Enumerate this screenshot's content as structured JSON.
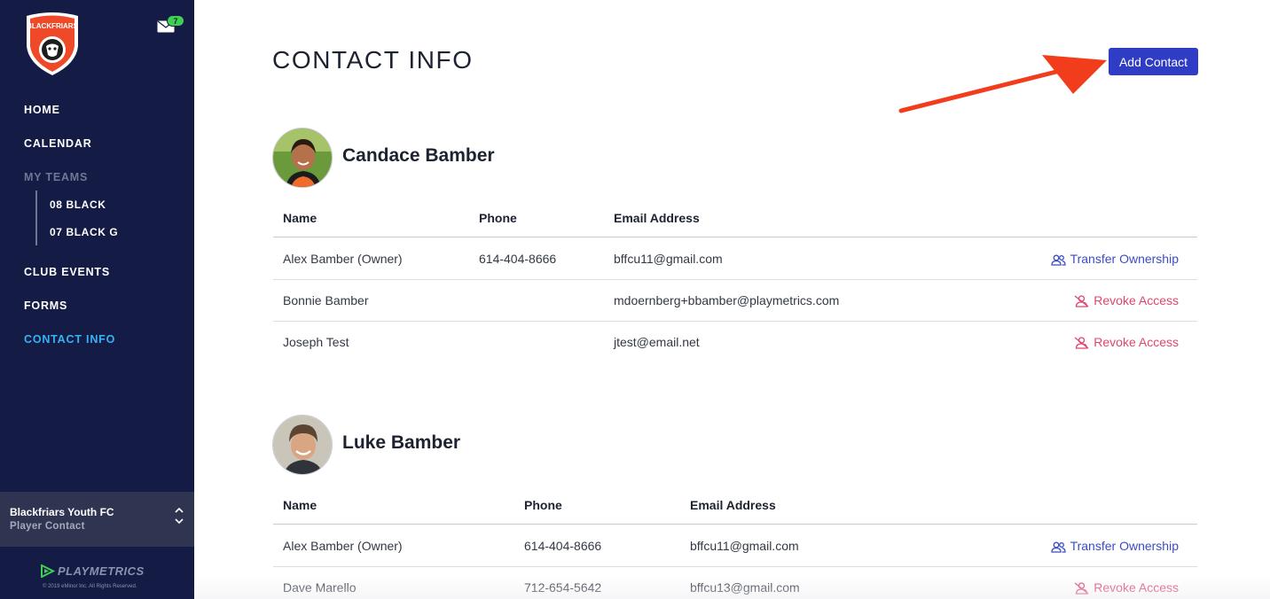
{
  "sidebar": {
    "logo_text": "BLACKFRIARS",
    "mail_count": "7",
    "nav": {
      "home": "HOME",
      "calendar": "CALENDAR",
      "my_teams": "MY TEAMS",
      "teams": [
        "08 BLACK",
        "07 BLACK G"
      ],
      "club_events": "CLUB EVENTS",
      "forms": "FORMS",
      "contact_info": "CONTACT INFO"
    },
    "org": {
      "name": "Blackfriars Youth FC",
      "subtitle": "Player Contact"
    },
    "brand": "PLAYMETRICS",
    "copyright": "© 2019 eMinor Inc. All Rights Reserved."
  },
  "main": {
    "title": "CONTACT INFO",
    "add_contact_label": "Add Contact",
    "players": [
      {
        "name": "Candace Bamber",
        "columns": [
          "Name",
          "Phone",
          "Email Address"
        ],
        "contacts": [
          {
            "name": "Alex Bamber (Owner)",
            "phone": "614-404-8666",
            "email": "bffcu11@gmail.com",
            "action": "Transfer Ownership"
          },
          {
            "name": "Bonnie Bamber",
            "phone": "",
            "email": "mdoernberg+bbamber@playmetrics.com",
            "action": "Revoke Access"
          },
          {
            "name": "Joseph Test",
            "phone": "",
            "email": "jtest@email.net",
            "action": "Revoke Access"
          }
        ]
      },
      {
        "name": "Luke Bamber",
        "columns": [
          "Name",
          "Phone",
          "Email Address"
        ],
        "contacts": [
          {
            "name": "Alex Bamber (Owner)",
            "phone": "614-404-8666",
            "email": "bffcu11@gmail.com",
            "action": "Transfer Ownership"
          },
          {
            "name": "Dave Marello",
            "phone": "712-654-5642",
            "email": "bffcu13@gmail.com",
            "action": "Revoke Access"
          }
        ]
      }
    ]
  },
  "colors": {
    "sidebar_bg": "#141b44",
    "active_nav": "#35b4f4",
    "primary_button": "#2f3cc6",
    "transfer_link": "#3d4bc7",
    "revoke_link": "#e0456f",
    "annotation_arrow": "#f23d1c"
  },
  "icons": [
    "blackfriars-lion-logo",
    "mail-icon",
    "chevron-up-down-icon",
    "playmetrics-logo-icon",
    "users-icon",
    "user-slash-icon",
    "red-arrow-annotation"
  ]
}
